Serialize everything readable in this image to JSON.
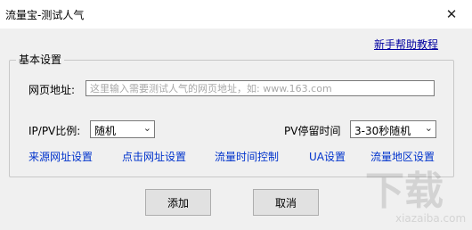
{
  "window": {
    "title": "流量宝-测试人气",
    "close_glyph": "✕"
  },
  "help_link": "新手帮助教程",
  "group": {
    "title": "基本设置",
    "url_label": "网页地址:",
    "url_placeholder": "这里输入需要测试人气的网页地址，如: www.163.com",
    "ratio_label": "IP/PV比例:",
    "ratio_value": "随机",
    "stay_label": "PV停留时间",
    "stay_value": "3-30秒随机",
    "links": [
      "来源网址设置",
      "点击网址设置",
      "流量时间控制",
      "UA设置",
      "流量地区设置"
    ]
  },
  "buttons": {
    "add": "添加",
    "cancel": "取消"
  },
  "watermark": {
    "text": "下载",
    "sub": "xiazaiba.com"
  },
  "icons": {
    "caret": "⌄"
  }
}
